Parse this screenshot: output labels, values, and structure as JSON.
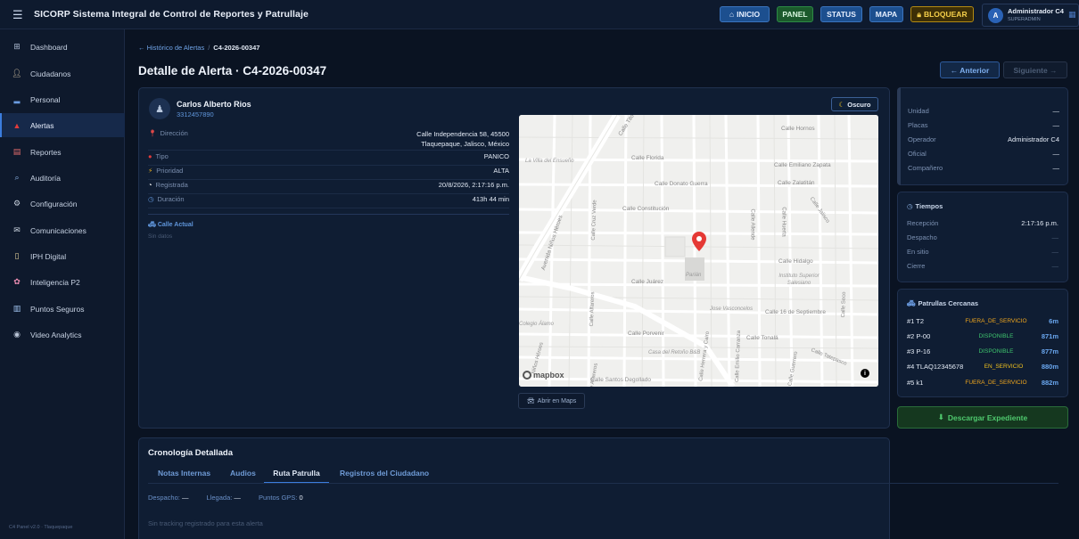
{
  "app": {
    "title": "SICORP Sistema Integral de Control de Reportes y Patrullaje",
    "menu_icon": "menu-icon",
    "footer": "C4 Panel v2.0 · Tlaquepaque"
  },
  "topnav": {
    "buttons": [
      {
        "label": "INICIO",
        "icon": "home-icon",
        "color": "#1c4f8f"
      },
      {
        "label": "PANEL",
        "color": "#1b5a2c"
      },
      {
        "label": "STATUS",
        "color": "#1c4f8f"
      },
      {
        "label": "MAPA",
        "color": "#1c4f8f"
      },
      {
        "label": "BLOQUEAR",
        "icon": "lock-icon",
        "color": "#3d2f06"
      }
    ],
    "user": {
      "initial": "A",
      "name": "Administrador C4",
      "role": "SUPERADMIN"
    }
  },
  "sidebar": {
    "items": [
      {
        "label": "Dashboard",
        "icon": "dashboard-icon"
      },
      {
        "label": "Ciudadanos",
        "icon": "user-icon"
      },
      {
        "label": "Personal",
        "icon": "police-icon"
      },
      {
        "label": "Alertas",
        "icon": "siren-icon",
        "active": true
      },
      {
        "label": "Reportes",
        "icon": "chart-icon"
      },
      {
        "label": "Auditoría",
        "icon": "magnifier-icon"
      },
      {
        "label": "Configuración",
        "icon": "gear-icon"
      },
      {
        "label": "Comunicaciones",
        "icon": "mail-icon"
      },
      {
        "label": "IPH Digital",
        "icon": "document-icon"
      },
      {
        "label": "Inteligencia P2",
        "icon": "brain-icon"
      },
      {
        "label": "Puntos Seguros",
        "icon": "building-icon"
      },
      {
        "label": "Video Analytics",
        "icon": "camera-icon"
      }
    ]
  },
  "header": {
    "breadcrumb_parent": "← Histórico de Alertas",
    "breadcrumb_sep": "/",
    "breadcrumb_current": "C4-2026-00347",
    "title": "Detalle de Alerta · C4-2026-00347",
    "prev_label": "← Anterior",
    "next_label": "Siguiente →"
  },
  "alert": {
    "person_name": "Carlos Alberto Rios",
    "person_phone": "3312457890",
    "fields": [
      {
        "label": "Dirección",
        "value": "Calle Independencia 58, 45500\nTlaquepaque, Jalisco, México",
        "icon": "pin-icon",
        "icon_color": "#e04848"
      },
      {
        "label": "Tipo",
        "value": "PANICO",
        "icon": "red-circle-icon",
        "icon_color": "#e03b3b"
      },
      {
        "label": "Prioridad",
        "value": "ALTA",
        "icon": "bolt-icon",
        "icon_color": "#f2b51d"
      },
      {
        "label": "Registrada",
        "value": "20/8/2026, 2:17:16 p.m.",
        "icon": "clock-icon",
        "icon_color": "#ffffff"
      },
      {
        "label": "Duración",
        "value": "413h 44 min",
        "icon": "timer-icon",
        "icon_color": "#5f95da"
      }
    ],
    "street_label": "Calle Actual",
    "street_value": "Sin datos",
    "theme_button": "Oscuro",
    "maps_button": "Abrir en Maps"
  },
  "map": {
    "attribution": "mapbox",
    "info": "i",
    "labels": [
      "Calle Hornos",
      "La Villa del Ensueño",
      "Calle Florida",
      "Calle Emiliano Zapata",
      "Calle Donato Guerra",
      "Calle Zalatitán",
      "Calle Constitución",
      "Avenida Niños Héroes",
      "Calle Cruz Verde",
      "Calle Allende",
      "Calle Huerta",
      "Calle Jalisco",
      "Calle Hidalgo",
      "Instituto Superior Salesiano",
      "Calle Juárez",
      "Parián",
      "Calle Alfareros",
      "Calle Seco",
      "Jose Vasconcelos",
      "Calle 16 de Septiembre",
      "Colegio Álamo",
      "Calle Porvenir",
      "Calle Tonalá",
      "Casa del Retoño B&B",
      "Calle Tatepasco",
      "Calle Santos Degollado",
      "Calle Herrera y Cairo",
      "Calle Emilio Carranza",
      "Calle Tito",
      "Calle Guerrero",
      "Niños Héroes",
      "Calle Alfareros"
    ]
  },
  "assignment": {
    "rows": [
      {
        "label": "Unidad",
        "value": "—"
      },
      {
        "label": "Placas",
        "value": "—"
      },
      {
        "label": "Operador",
        "value": "Administrador C4"
      },
      {
        "label": "Oficial",
        "value": "—"
      },
      {
        "label": "Compañero",
        "value": "—"
      }
    ]
  },
  "tiempos": {
    "title": "Tiempos",
    "icon": "clock-icon",
    "rows": [
      {
        "label": "Recepción",
        "value": "2:17:16 p.m."
      },
      {
        "label": "Despacho",
        "value": "—"
      },
      {
        "label": "En sitio",
        "value": "—"
      },
      {
        "label": "Cierre",
        "value": "—"
      }
    ]
  },
  "patrullas": {
    "title": "Patrullas Cercanas",
    "icon": "police-car-icon",
    "rows": [
      {
        "num": "#1 T2",
        "status": "FUERA_DE_SERVICIO",
        "dist": "6m",
        "status_color": "#f2a81d"
      },
      {
        "num": "#2 P-00",
        "status": "DISPONIBLE",
        "dist": "871m",
        "status_color": "#3ec46d"
      },
      {
        "num": "#3 P-16",
        "status": "DISPONIBLE",
        "dist": "877m",
        "status_color": "#3ec46d"
      },
      {
        "num": "#4 TLAQ12345678",
        "status": "EN_SERVICIO",
        "dist": "880m",
        "status_color": "#f2c21d"
      },
      {
        "num": "#5 k1",
        "status": "FUERA_DE_SERVICIO",
        "dist": "882m",
        "status_color": "#f2a81d"
      }
    ]
  },
  "download_button": "Descargar Expediente",
  "timeline": {
    "title": "Cronología Detallada",
    "tabs": [
      "Notas Internas",
      "Audios",
      "Ruta Patrulla",
      "Registros del Ciudadano"
    ],
    "active_tab": 2,
    "despacho_label": "Despacho:",
    "despacho_value": "—",
    "llegada_label": "Llegada:",
    "llegada_value": "—",
    "gps_label": "Puntos GPS:",
    "gps_value": "0",
    "empty": "Sin tracking registrado para esta alerta"
  }
}
